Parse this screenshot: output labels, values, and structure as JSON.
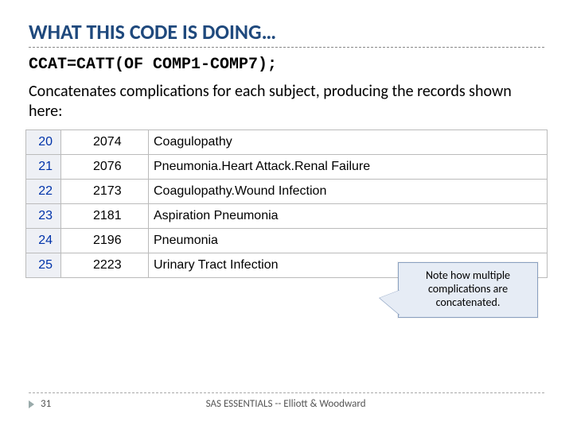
{
  "title": "WHAT THIS CODE IS DOING…",
  "code": "CCAT=CATT(OF COMP1-COMP7);",
  "description": "Concatenates complications for each subject, producing the records shown here:",
  "rows": [
    {
      "n": "20",
      "id": "2074",
      "comp": "Coagulopathy"
    },
    {
      "n": "21",
      "id": "2076",
      "comp": "Pneumonia.Heart Attack.Renal Failure"
    },
    {
      "n": "22",
      "id": "2173",
      "comp": "Coagulopathy.Wound Infection"
    },
    {
      "n": "23",
      "id": "2181",
      "comp": "Aspiration Pneumonia"
    },
    {
      "n": "24",
      "id": "2196",
      "comp": "Pneumonia"
    },
    {
      "n": "25",
      "id": "2223",
      "comp": "Urinary Tract Infection"
    }
  ],
  "callout": "Note how multiple complications are concatenated.",
  "page": "31",
  "footer": "SAS ESSENTIALS -- Elliott & Woodward"
}
